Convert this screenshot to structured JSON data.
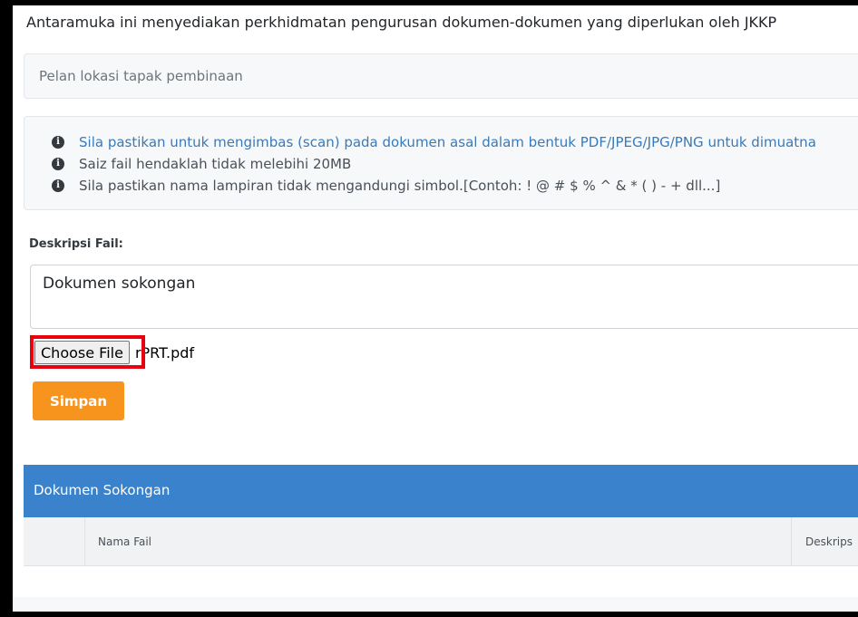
{
  "intro": {
    "text": "Antaramuka ini menyediakan perkhidmatan pengurusan dokumen-dokumen yang diperlukan oleh JKKP"
  },
  "document_name": "Pelan lokasi tapak pembinaan",
  "info": {
    "lines": [
      "Sila pastikan untuk mengimbas (scan) pada dokumen asal dalam bentuk PDF/JPEG/JPG/PNG untuk dimuatna",
      "Saiz fail hendaklah tidak melebihi 20MB",
      "Sila pastikan nama lampiran tidak mengandungi simbol.[Contoh: ! @ # $ % ^ & * ( ) - + dll...]"
    ],
    "icon": "info-circle-icon"
  },
  "form": {
    "description_label": "Deskripsi Fail:",
    "description_value": "Dokumen sokongan",
    "choose_file_label": "Choose File",
    "file_name": "rPRT.pdf",
    "save_label": "Simpan"
  },
  "table": {
    "title": "Dokumen Sokongan",
    "columns": [
      "",
      "Nama Fail",
      "Deskrips"
    ]
  },
  "colors": {
    "header_blue": "#3a82cc",
    "save_orange": "#f7941d",
    "highlight_red": "#e8000e",
    "info_blue": "#3a7ab7"
  }
}
